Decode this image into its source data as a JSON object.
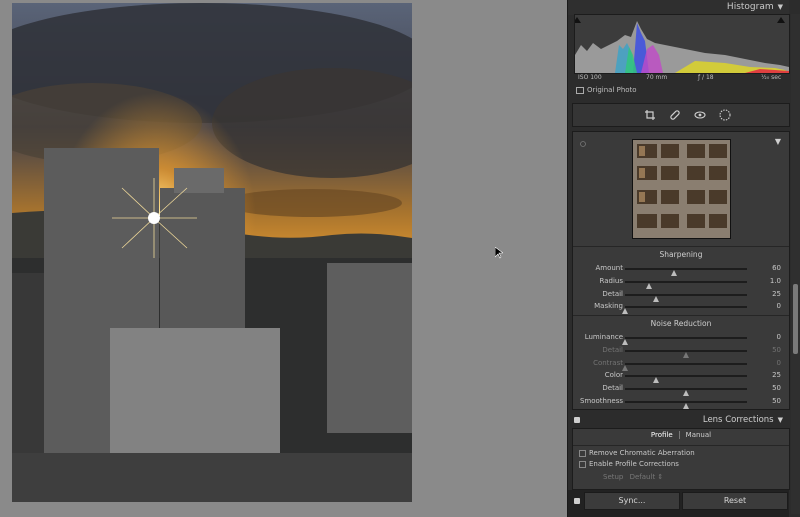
{
  "histogram": {
    "title": "Histogram",
    "iso": "ISO 100",
    "focal": "70 mm",
    "aperture": "ƒ / 18",
    "shutter": "⅟₂₀ sec",
    "original_photo": "Original Photo"
  },
  "tools": [
    "crop-icon",
    "healing-icon",
    "red-eye-icon",
    "masking-icon"
  ],
  "detail": {
    "sharpening": {
      "title": "Sharpening",
      "rows": [
        {
          "label": "Amount",
          "value": "60",
          "level": 0.4
        },
        {
          "label": "Radius",
          "value": "1.0",
          "level": 0.2
        },
        {
          "label": "Detail",
          "value": "25",
          "level": 0.25
        },
        {
          "label": "Masking",
          "value": "0",
          "level": 0.0
        }
      ]
    },
    "noise": {
      "title": "Noise Reduction",
      "rows": [
        {
          "label": "Luminance",
          "value": "0",
          "level": 0.0,
          "dim": false
        },
        {
          "label": "Detail",
          "value": "50",
          "level": 0.5,
          "dim": true
        },
        {
          "label": "Contrast",
          "value": "0",
          "level": 0.0,
          "dim": true
        },
        {
          "label": "Color",
          "value": "25",
          "level": 0.25,
          "dim": false
        },
        {
          "label": "Detail",
          "value": "50",
          "level": 0.5,
          "dim": false
        },
        {
          "label": "Smoothness",
          "value": "50",
          "level": 0.5,
          "dim": false
        }
      ]
    }
  },
  "lens": {
    "title": "Lens Corrections",
    "tabs": [
      "Profile",
      "Manual"
    ],
    "remove_ca": "Remove Chromatic Aberration",
    "enable_profile": "Enable Profile Corrections",
    "setup_label": "Setup",
    "setup_value": "Default ⇕"
  },
  "buttons": {
    "sync": "Sync...",
    "reset": "Reset"
  }
}
